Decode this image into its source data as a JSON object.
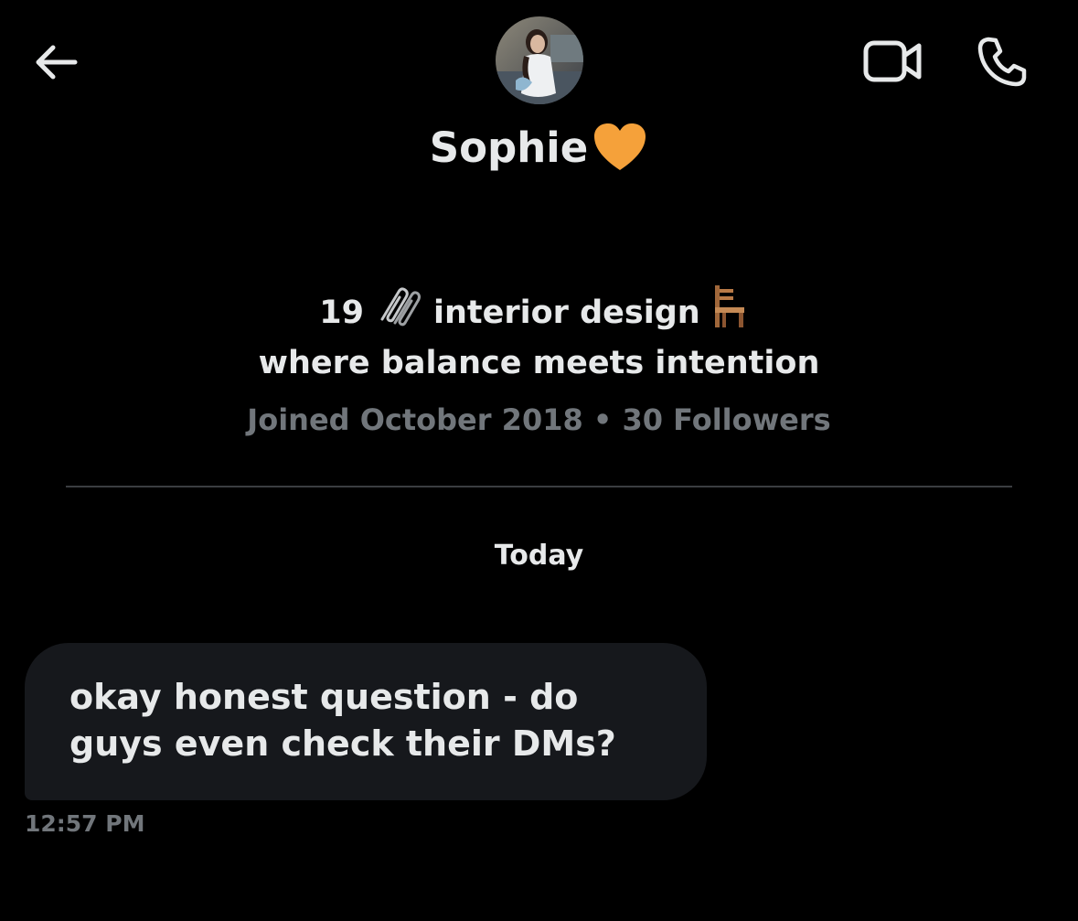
{
  "header": {
    "back_icon": "arrow-left-icon",
    "video_icon": "video-camera-icon",
    "phone_icon": "phone-icon"
  },
  "profile": {
    "display_name": "Sophie",
    "name_emoji": "orange-heart-icon",
    "avatar_icon": "avatar-photo",
    "bio": {
      "age": "19",
      "age_emoji": "paperclips-icon",
      "topic": "interior design",
      "topic_emoji": "chair-icon",
      "tagline": "where balance meets intention"
    },
    "meta": "Joined October 2018 • 30 Followers"
  },
  "conversation": {
    "day_label": "Today",
    "messages": [
      {
        "text": "okay honest question - do guys even check their DMs?",
        "time": "12:57 PM",
        "direction": "incoming"
      }
    ]
  },
  "colors": {
    "background": "#000000",
    "primary_text": "#e7e9ea",
    "secondary_text": "#71767b",
    "bubble": "#16181c",
    "divider": "#3a3d41",
    "heart": "#f5a13a"
  }
}
